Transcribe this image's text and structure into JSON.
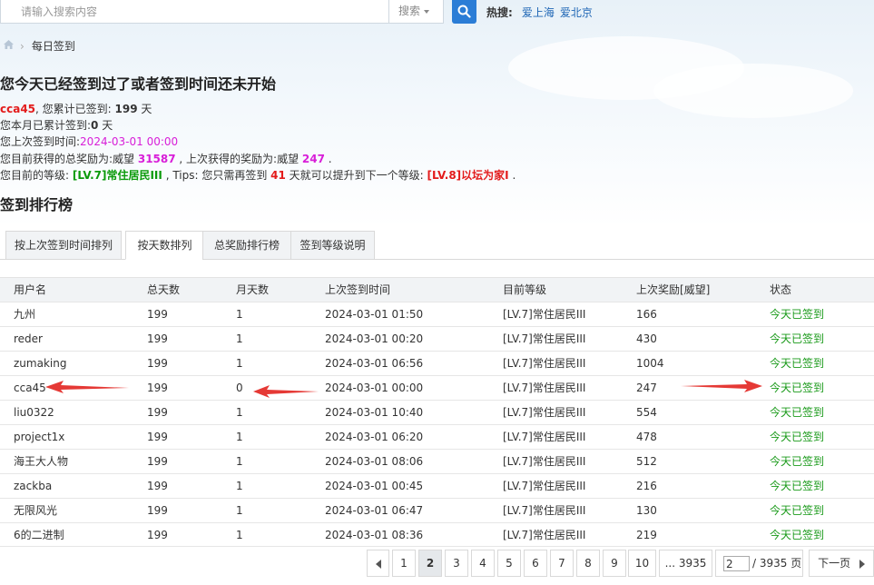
{
  "search": {
    "placeholder": "请输入搜索内容",
    "type_label": "搜索",
    "hot_label": "热搜:",
    "hot_links": [
      "爱上海",
      "爱北京"
    ]
  },
  "breadcrumb": {
    "current": "每日签到"
  },
  "title": "您今天已经签到过了或者签到时间还未开始",
  "info": {
    "username": "cca45",
    "line1_mid": ", 您累计已签到: ",
    "total_days": "199",
    "day_unit": " 天",
    "line2_pre": "您本月已累计签到:",
    "month_days": "0",
    "line3_pre": "您上次签到时间:",
    "last_time": "2024-03-01 00:00",
    "line4_pre": "您目前获得的总奖励为:威望 ",
    "total_reward": "31587",
    "line4_mid": " , 上次获得的奖励为:威望 ",
    "last_reward": "247",
    "line4_end": " .",
    "line5_pre": "您目前的等级: ",
    "level": "[LV.7]常住居民III",
    "line5_mid": " , Tips: 您只需再签到 ",
    "need_days": "41",
    "line5_mid2": " 天就可以提升到下一个等级: ",
    "next_level": "[LV.8]以坛为家I",
    "line5_end": " ."
  },
  "rank_title": "签到排行榜",
  "tabs": [
    "按上次签到时间排列",
    "按天数排列",
    "总奖励排行榜",
    "签到等级说明"
  ],
  "active_tab": 1,
  "table": {
    "headers": [
      "用户名",
      "总天数",
      "月天数",
      "上次签到时间",
      "目前等级",
      "上次奖励[威望]",
      "状态"
    ],
    "rows": [
      [
        "九州",
        "199",
        "1",
        "2024-03-01 01:50",
        "[LV.7]常住居民III",
        "166",
        "今天已签到"
      ],
      [
        "reder",
        "199",
        "1",
        "2024-03-01 00:20",
        "[LV.7]常住居民III",
        "430",
        "今天已签到"
      ],
      [
        "zumaking",
        "199",
        "1",
        "2024-03-01 06:56",
        "[LV.7]常住居民III",
        "1004",
        "今天已签到"
      ],
      [
        "cca45",
        "199",
        "0",
        "2024-03-01 00:00",
        "[LV.7]常住居民III",
        "247",
        "今天已签到"
      ],
      [
        "liu0322",
        "199",
        "1",
        "2024-03-01 10:40",
        "[LV.7]常住居民III",
        "554",
        "今天已签到"
      ],
      [
        "project1x",
        "199",
        "1",
        "2024-03-01 06:20",
        "[LV.7]常住居民III",
        "478",
        "今天已签到"
      ],
      [
        "海王大人物",
        "199",
        "1",
        "2024-03-01 08:06",
        "[LV.7]常住居民III",
        "512",
        "今天已签到"
      ],
      [
        "zackba",
        "199",
        "1",
        "2024-03-01 00:45",
        "[LV.7]常住居民III",
        "216",
        "今天已签到"
      ],
      [
        "无限风光",
        "199",
        "1",
        "2024-03-01 06:47",
        "[LV.7]常住居民III",
        "130",
        "今天已签到"
      ],
      [
        "6的二进制",
        "199",
        "1",
        "2024-03-01 08:36",
        "[LV.7]常住居民III",
        "219",
        "今天已签到"
      ]
    ]
  },
  "pagination": {
    "pages": [
      "1",
      "2",
      "3",
      "4",
      "5",
      "6",
      "7",
      "8",
      "9",
      "10",
      "... 3935"
    ],
    "current_page": "2",
    "input_value": "2",
    "total_label": "/ 3935 页",
    "next_label": "下一页"
  },
  "colors": {
    "accent": "#2b7dd6",
    "link": "#1f66b5",
    "username_red": "#e31b1b",
    "reward_pink": "#d81ed8",
    "level_green": "#0a9a0a",
    "status_green": "#1a9a1a",
    "arrow_red": "#e53935"
  }
}
